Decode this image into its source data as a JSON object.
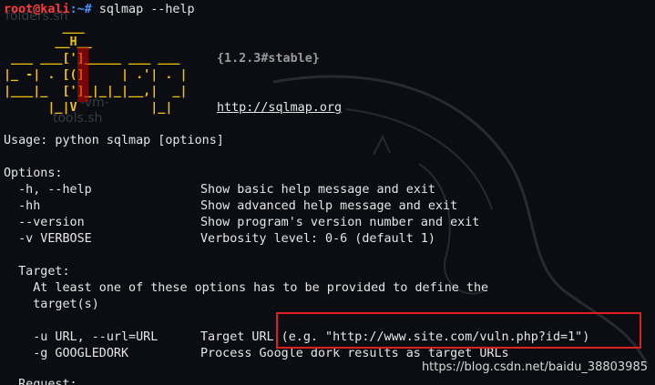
{
  "prompt": {
    "user_host": "root@kali",
    "path": ":~# ",
    "command": "sqlmap --help"
  },
  "desktop_labels": {
    "folders": "folders.sh",
    "vm_tools_a": "-vm-",
    "vm_tools_b": "tools.sh"
  },
  "logo": {
    "lines": [
      "        ___",
      "       __H__",
      " ___ ___[']_____ ___ ___  ",
      "|_ -| . [(]     | .'| . |",
      "|___|_  [']_|_|_|__,|  _|",
      "      |_|V          |_|   "
    ],
    "version": "{1.2.3#stable}",
    "url": "http://sqlmap.org"
  },
  "usage": "Usage: python sqlmap [options]",
  "options_header": "Options:",
  "options": [
    {
      "flag": "  -h, --help",
      "desc": "Show basic help message and exit"
    },
    {
      "flag": "  -hh",
      "desc": "Show advanced help message and exit"
    },
    {
      "flag": "  --version",
      "desc": "Show program's version number and exit"
    },
    {
      "flag": "  -v VERBOSE",
      "desc": "Verbosity level: 0-6 (default 1)"
    }
  ],
  "target": {
    "header": "  Target:",
    "desc_line1": "    At least one of these options has to be provided to define the",
    "desc_line2": "    target(s)",
    "items": [
      {
        "flag": "    -u URL, --url=URL",
        "desc": "Target URL (e.g. \"http://www.site.com/vuln.php?id=1\")"
      },
      {
        "flag": "    -g GOOGLEDORK",
        "desc": "Process Google dork results as target URLs"
      }
    ]
  },
  "request_header": "  Request:",
  "watermark": "https://blog.csdn.net/baidu_38803985",
  "colors": {
    "background": "#0b0d12",
    "prompt_user": "#ff3b3b",
    "prompt_path": "#4a90ff",
    "logo": "#f2c300",
    "highlight": "#e02020"
  }
}
